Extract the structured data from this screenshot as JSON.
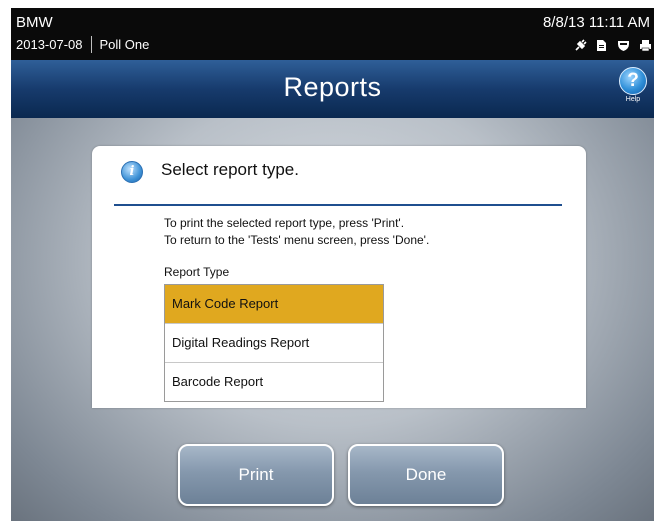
{
  "status": {
    "election_name": "BMW",
    "date": "2013-07-08",
    "poll": "Poll One",
    "datetime": "8/8/13  11:11 AM",
    "icons": [
      "power-plug-icon",
      "memory-card-icon",
      "shield-icon",
      "printer-icon"
    ]
  },
  "header": {
    "title": "Reports",
    "help_label": "Help",
    "help_glyph": "?"
  },
  "dialog": {
    "icon": "info-icon",
    "info_glyph": "i",
    "title": "Select report type.",
    "instruction_1": "To print the selected report type, press 'Print'.",
    "instruction_2": "To return to the 'Tests' menu screen, press 'Done'.",
    "list_label": "Report Type",
    "report_types": [
      {
        "label": "Mark Code Report",
        "selected": true
      },
      {
        "label": "Digital Readings Report",
        "selected": false
      },
      {
        "label": "Barcode Report",
        "selected": false
      }
    ]
  },
  "buttons": {
    "print_label": "Print",
    "done_label": "Done"
  },
  "colors": {
    "header_blue": "#173b6d",
    "selection_gold": "#e0a81f",
    "button_blue_gray": "#8598ad"
  }
}
